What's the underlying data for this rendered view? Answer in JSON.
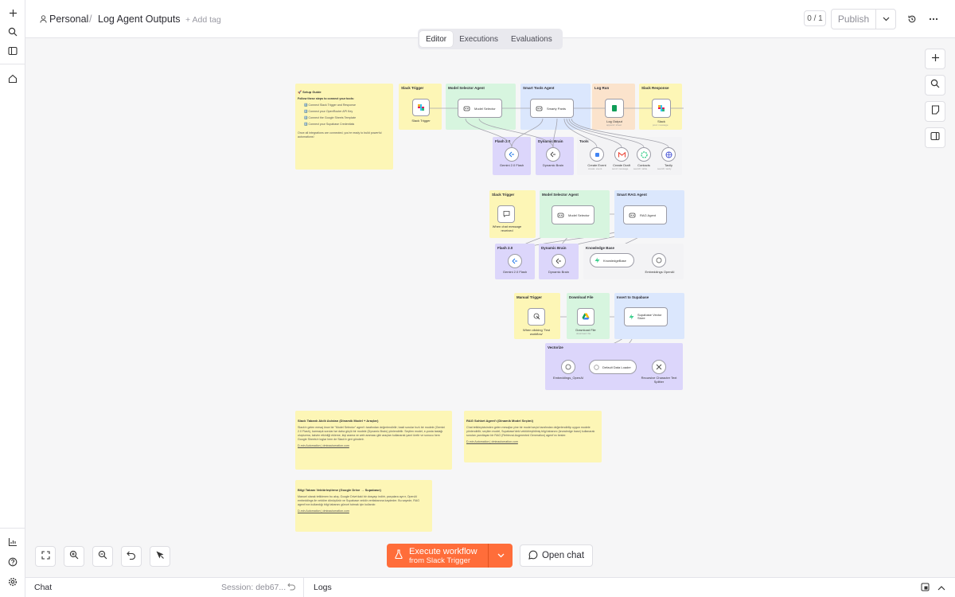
{
  "header": {
    "project": "Personal",
    "separator": "/",
    "workflow_name": "Log Agent Outputs",
    "add_tag": "+ Add tag",
    "counter": "0 / 1",
    "publish": "Publish"
  },
  "tabs": [
    "Editor",
    "Executions",
    "Evaluations"
  ],
  "workflow": {
    "setup_guide": {
      "title": "🚀 Setup Guide",
      "intro": "Follow these steps to connect your tools:",
      "steps": [
        "1️⃣ Connect Slack Trigger and Response",
        "2️⃣ Connect your OpenRouter API Key",
        "3️⃣ Connect the Google Sheets Template",
        "4️⃣ Connect your Supabase Credentials"
      ],
      "footer": "Once all integrations are connected, you're ready to build powerful automations!"
    },
    "group1": {
      "sticky_slack_trigger": "Slack Trigger",
      "sticky_model_selector": "Model Selector Agent",
      "sticky_smart_tools": "Smart Tools Agent",
      "sticky_log_run": "Log Run",
      "sticky_slack_response": "Slack Response",
      "sticky_flash": "Flash 2.0",
      "sticky_dynamic": "Dynamic Brain",
      "tools_label": "Tools",
      "node_slack_trigger": "Slack Trigger",
      "node_model_selector": "Model Selector",
      "node_smart_tools": "Smarty Pants",
      "node_log_output": "Log Output",
      "node_log_output_sub": "append: sheet",
      "node_slack": "Slack",
      "node_slack_sub": "post: message",
      "node_gemini": "Gemini 2.0 Flash",
      "node_dynamic": "Dynamic Brain",
      "node_create_event": "Create Event",
      "node_create_event_sub": "create: event",
      "node_create_draft": "Create Draft",
      "node_create_draft_sub": "send: message",
      "node_contacts": "Contacts",
      "node_contacts_sub": "search: table",
      "node_tavily": "Tavily",
      "node_tavily_sub": "search: tavily"
    },
    "group2": {
      "sticky_slack_trigger": "Slack Trigger",
      "sticky_model_selector": "Model Selector Agent",
      "sticky_rag": "Smart RAG Agent",
      "sticky_flash": "Flash 2.0",
      "sticky_dynamic": "Dynamic Brain",
      "knowledge_label": "Knowledge Base",
      "node_chat": "When chat message received",
      "node_model_selector": "Model Selector",
      "node_rag": "RAG Agent",
      "node_gemini": "Gemini 2.0 Flash",
      "node_dynamic": "Dynamic Brain",
      "node_knowledge": "KnowledgeBase",
      "node_embeddings": "Embeddings OpenAI"
    },
    "group3": {
      "sticky_manual": "Manual Trigger",
      "sticky_download": "Download File",
      "sticky_insert": "Insert to Supabase",
      "sticky_vectorize": "Vectorize",
      "node_manual": "When clicking 'Test workflow'",
      "node_download": "Download File",
      "node_download_sub": "download: file",
      "node_supabase": "Supabase Vector Store",
      "node_embeddings": "Embeddings_OpenAI",
      "node_loader": "Default Data Loader",
      "node_splitter": "Recursive Character Text Splitter"
    },
    "notes": {
      "slack_title": "Slack Tabanlı Akıllı Asistan (Dinamik Model + Araçlar)",
      "slack_body": "Slack'e gelen mesaj önce bir \"Model Selector\" agent'ı tarafından değerlendirilir; basit sorular hızlı bir modele (Gemini 2.0 Flash), karmaşık sorular ise daha güçlü bir modele (Dynamic Brain) yönlendirilir. Seçilen model, e-posta taslağı oluşturma, takvim etkinliği ekleme, kişi arama ve web araması gibi araçları kullanarak yanıt üretir ve sonucu hem Google Sheets'e loglar hem de Slack'e geri gönderir.",
      "slack_footer": "D-min Automation | dminautomation.com",
      "rag_title": "RAG Sohbet Agent'ı (Dinamik Model Seçimi)",
      "rag_body": "Chat tetikleyicisinden gelen mesajlar yine bir model seçici tarafından değerlendirilip uygun modele yönlendirilir; seçilen model, Supabase'deki vektörleştirilmiş bilgi tabanını (knowledge base) kullanarak soruları yanıtlayan bir RAG (Retrieval-Augmented Generation) agent'ını besler.",
      "rag_footer": "D-min Automation | dminautomation.com",
      "kb_title": "Bilgi Tabanı Vektörleştirme (Google Drive → Supabase)",
      "kb_body": "Manuel olarak tetiklenen bu akış, Google Drive'daki bir dosyayı indirir, parçalara ayırır, OpenAI embeddings ile vektöre dönüştürür ve Supabase vektör veritabanına kaydeder. Bu sayede, RAG agent'ının kullandığı bilgi tabanını güncel tutmak için kullanılır.",
      "kb_footer": "D-min Automation | dminautomation.com"
    }
  },
  "execute": {
    "label": "Execute workflow",
    "sublabel": "from Slack Trigger"
  },
  "open_chat": "Open chat",
  "bottom": {
    "chat": "Chat",
    "session": "Session: deb67...",
    "logs": "Logs"
  },
  "colors": {
    "accent": "#ff6d3a",
    "sticky_yellow": "#fdf6b6",
    "sticky_green": "#d7f5df",
    "sticky_blue": "#dbe7fd",
    "sticky_orange": "#fbe3cc",
    "sticky_purple": "#dcd6fb",
    "slack_pink": "#e01e5a",
    "sheets_green": "#0f9d58",
    "gmail_red": "#ea4335"
  }
}
